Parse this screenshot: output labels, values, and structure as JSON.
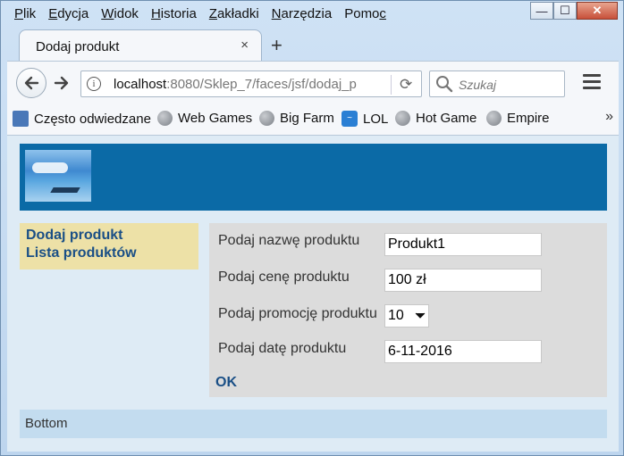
{
  "menu": [
    "Plik",
    "Edycja",
    "Widok",
    "Historia",
    "Zakładki",
    "Narzędzia",
    "Pomoc"
  ],
  "menu_underline": [
    "P",
    "E",
    "W",
    "H",
    "Z",
    "N",
    "c"
  ],
  "window_controls": {
    "minimize": "—",
    "maximize": "☐",
    "close": "✕"
  },
  "tab": {
    "title": "Dodaj produkt",
    "close": "×",
    "new_tab": "+"
  },
  "urlbar": {
    "host": "localhost",
    "path": ":8080/Sklep_7/faces/jsf/dodaj_p"
  },
  "search": {
    "placeholder": "Szukaj"
  },
  "bookmarks": [
    {
      "label": "Często odwiedzane",
      "icon": "often-visited-icon"
    },
    {
      "label": "Web Games",
      "icon": "globe-icon"
    },
    {
      "label": "Big Farm",
      "icon": "globe-icon"
    },
    {
      "label": "LOL",
      "icon": "lol-icon"
    },
    {
      "label": "Hot Game",
      "icon": "globe-icon"
    },
    {
      "label": "Empire",
      "icon": "globe-icon"
    }
  ],
  "bookmarks_more": "»",
  "sidebar": {
    "links": [
      "Dodaj produkt",
      "Lista produktów"
    ]
  },
  "form": {
    "name_label": "Podaj nazwę produktu",
    "name_value": "Produkt1",
    "price_label": "Podaj cenę produktu",
    "price_value": "100 zł",
    "promo_label": "Podaj promocję produktu",
    "promo_value": "10",
    "date_label": "Podaj datę produktu",
    "date_value": "6-11-2016",
    "ok": "OK"
  },
  "footer": {
    "text": "Bottom"
  },
  "colors": {
    "header": "#0b6aa6",
    "sidebar": "#ede1a7",
    "link": "#1a4f86",
    "content": "#dcdcdc",
    "footer": "#c3dcef"
  }
}
